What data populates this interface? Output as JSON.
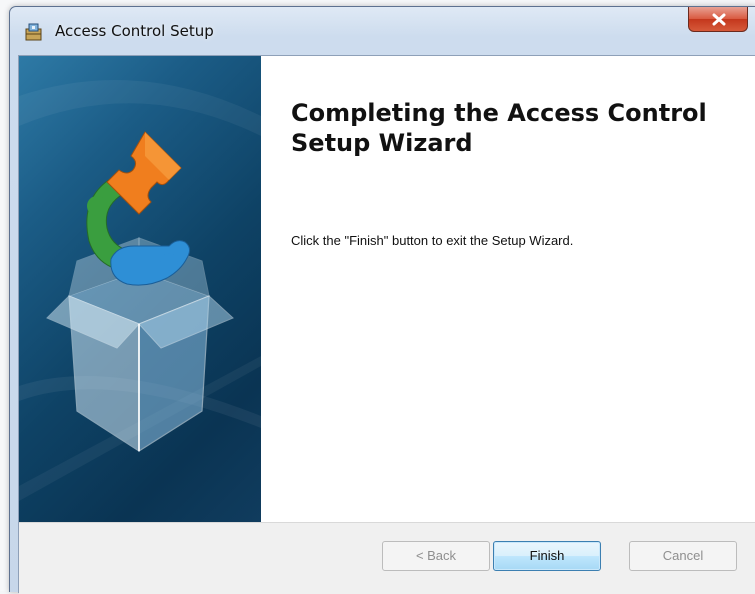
{
  "window": {
    "title": "Access Control Setup",
    "icon": "setup-package-icon",
    "close_icon": "close-icon"
  },
  "banner": {
    "image": "puzzle-box-artwork"
  },
  "content": {
    "heading": "Completing the Access Control Setup Wizard",
    "message": "Click the \"Finish\" button to exit the Setup Wizard."
  },
  "buttons": {
    "back": "< Back",
    "finish": "Finish",
    "cancel": "Cancel"
  },
  "colors": {
    "close_button": "#c4371d",
    "banner_dark": "#0a3453",
    "puzzle_orange": "#f07e1e",
    "puzzle_green": "#3a9e3f",
    "puzzle_blue": "#2e8fd6",
    "default_button_border": "#3c7fb1"
  }
}
